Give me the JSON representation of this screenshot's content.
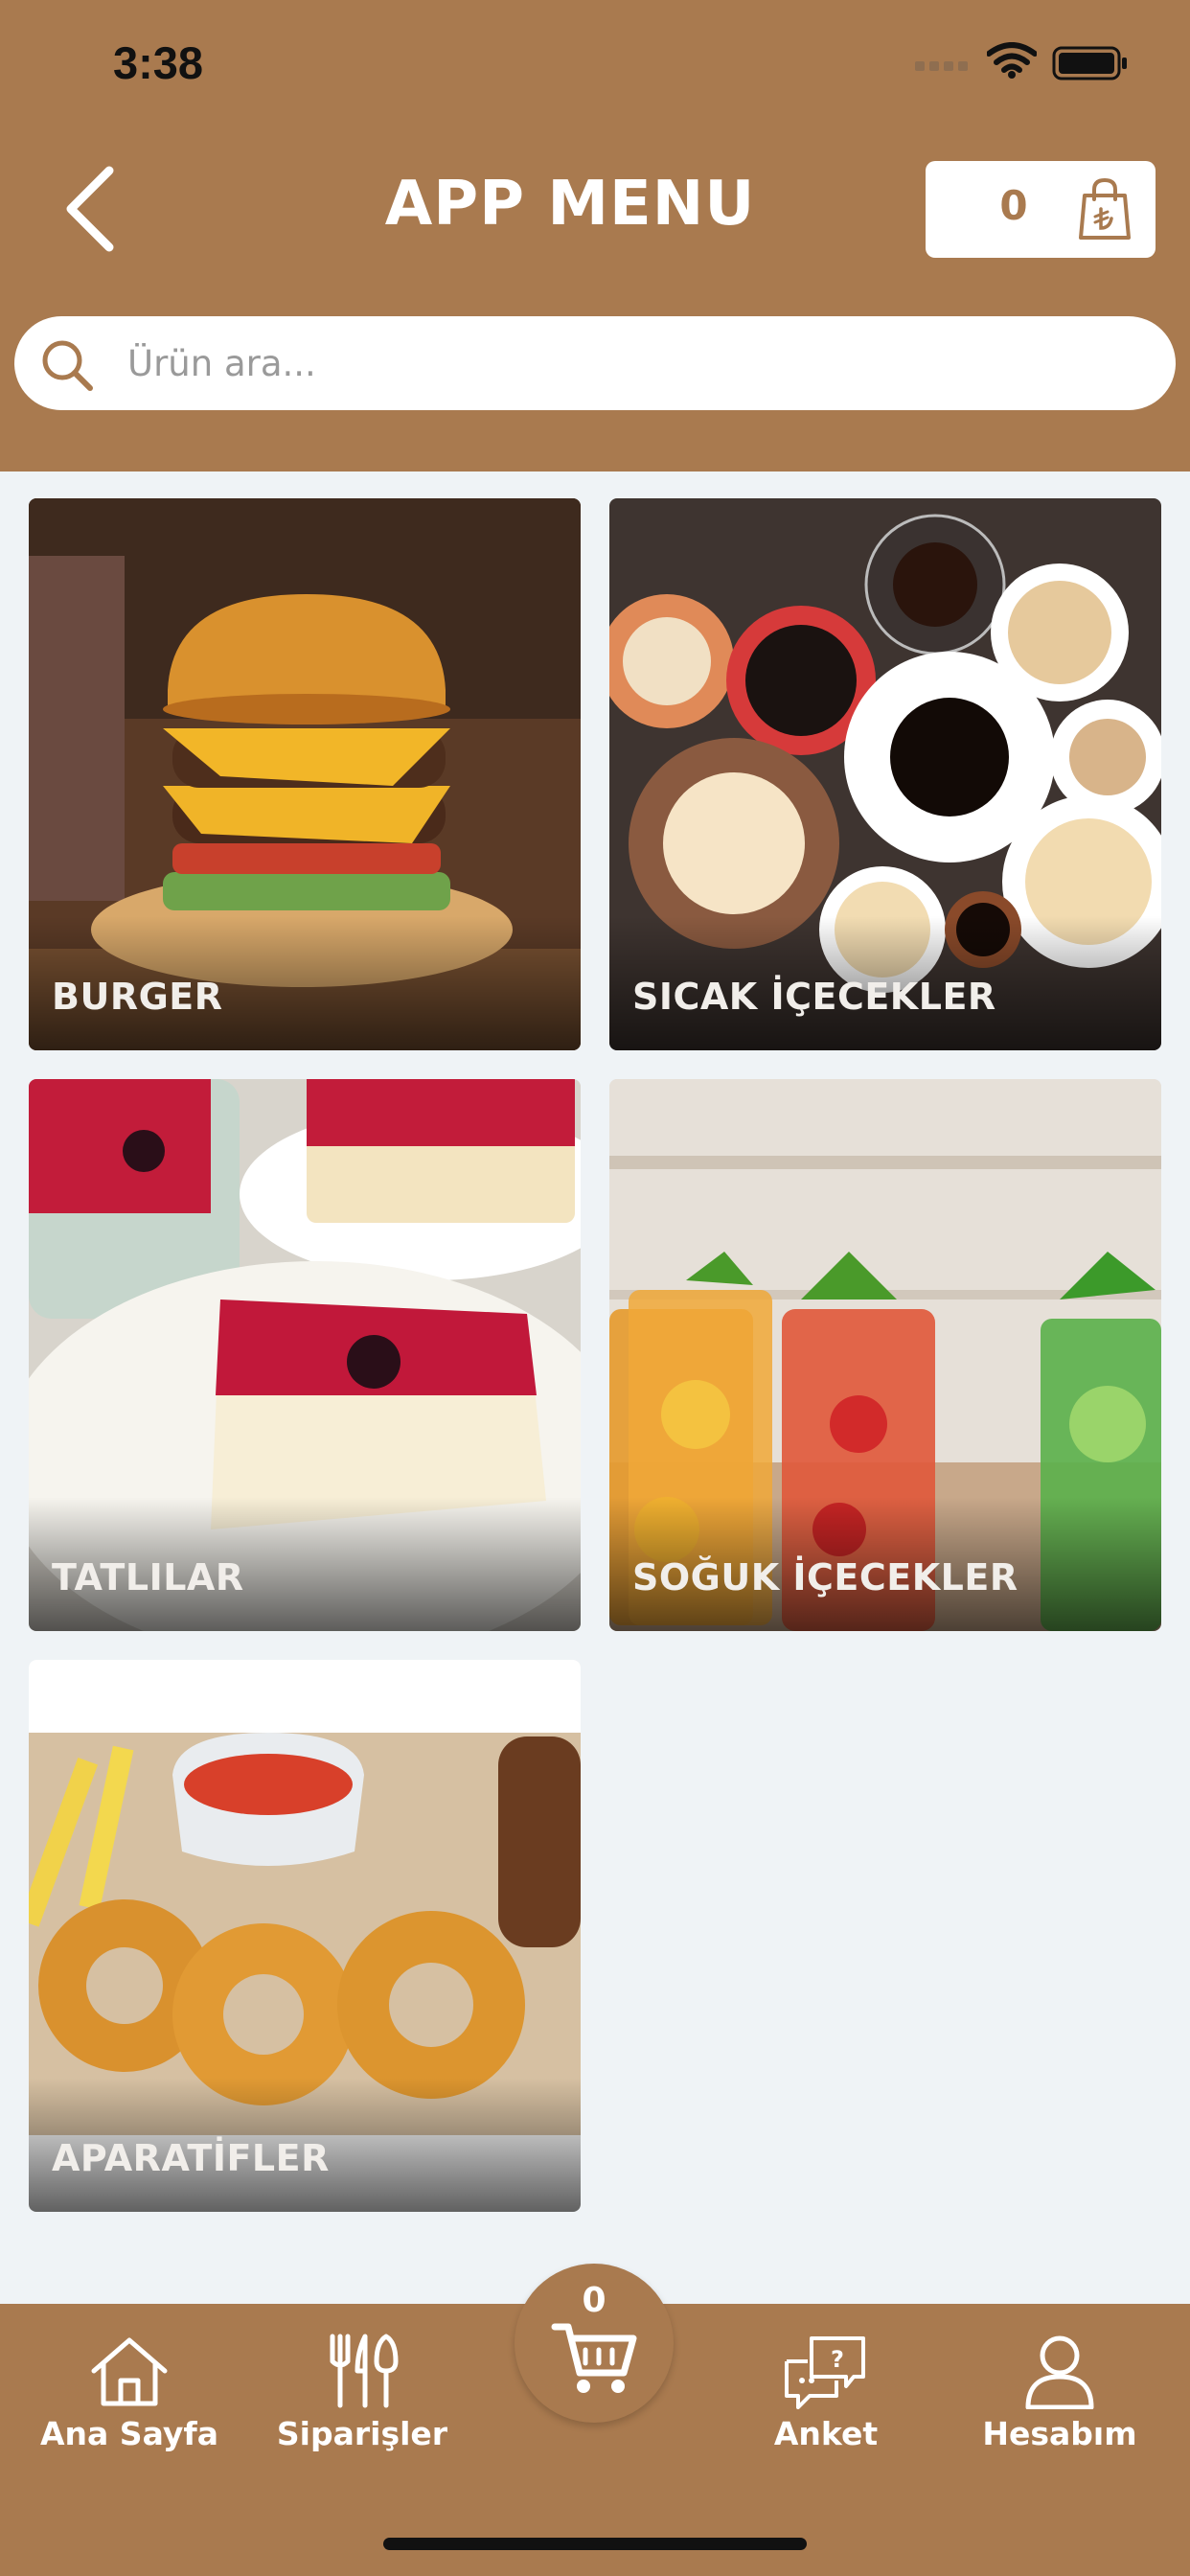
{
  "status_bar": {
    "time": "3:38"
  },
  "header": {
    "title": "APP MENU",
    "cart_count": "0",
    "back_icon": "chevron-left-icon",
    "cart_icon": "lira-bag-icon"
  },
  "search": {
    "placeholder": "Ürün ara..."
  },
  "categories": [
    {
      "label": "BURGER"
    },
    {
      "label": "SICAK İÇECEKLER"
    },
    {
      "label": "TATLILAR"
    },
    {
      "label": "SOĞUK İÇECEKLER"
    },
    {
      "label": "APARATİFLER"
    }
  ],
  "tabbar": {
    "items": [
      {
        "label": "Ana Sayfa",
        "icon": "home-icon"
      },
      {
        "label": "Siparişler",
        "icon": "cutlery-icon"
      },
      {
        "label": "Anket",
        "icon": "chat-question-icon"
      },
      {
        "label": "Hesabım",
        "icon": "user-icon"
      }
    ],
    "cart_count": "0"
  },
  "colors": {
    "brand": "#a97a4f",
    "background": "#eff3f6",
    "card_text": "#f1eeea"
  }
}
